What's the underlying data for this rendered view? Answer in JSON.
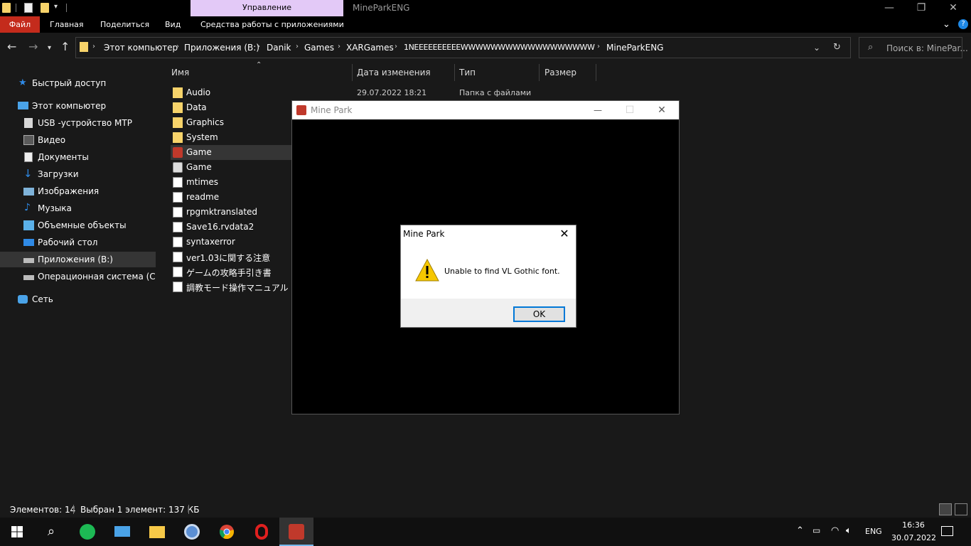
{
  "titlebar": {
    "manage_tab": "Управление",
    "window_title": "MineParkENG",
    "minimize": "—",
    "maximize": "❐",
    "close": "✕"
  },
  "ribbon": {
    "tabs": [
      "Файл",
      "Главная",
      "Поделиться",
      "Вид",
      "Средства работы с приложениями"
    ],
    "expand_icon": "⌄",
    "help_icon": "?"
  },
  "address": {
    "crumbs": [
      "Этот компьютер",
      "Приложения (B:)",
      "Danik",
      "Games",
      "XARGames",
      "1NEEEEEEEEEEWWWWWWWWWWWWWWWWWW",
      "MineParkENG"
    ],
    "search_placeholder": "Поиск в: MinePar..."
  },
  "nav": {
    "items": [
      {
        "label": "Быстрый доступ",
        "icon": "star-icon"
      },
      {
        "label": "Этот компьютер",
        "icon": "computer-icon"
      },
      {
        "label": "USB -устройство MTP",
        "icon": "usb-device-icon"
      },
      {
        "label": "Видео",
        "icon": "video-icon"
      },
      {
        "label": "Документы",
        "icon": "documents-icon"
      },
      {
        "label": "Загрузки",
        "icon": "downloads-icon"
      },
      {
        "label": "Изображения",
        "icon": "pictures-icon"
      },
      {
        "label": "Музыка",
        "icon": "music-icon"
      },
      {
        "label": "Объемные объекты",
        "icon": "3d-objects-icon"
      },
      {
        "label": "Рабочий стол",
        "icon": "desktop-icon"
      },
      {
        "label": "Приложения (B:)",
        "icon": "drive-icon"
      },
      {
        "label": "Операционная система (C:)",
        "icon": "drive-icon"
      },
      {
        "label": "Сеть",
        "icon": "network-icon"
      }
    ]
  },
  "filelist": {
    "columns": [
      "Имя",
      "Дата изменения",
      "Тип",
      "Размер"
    ],
    "first_row_date": "29.07.2022 18:21",
    "first_row_type": "Папка с файлами",
    "files": [
      {
        "name": "Audio",
        "icon": "folder-icon"
      },
      {
        "name": "Data",
        "icon": "folder-icon"
      },
      {
        "name": "Graphics",
        "icon": "folder-icon"
      },
      {
        "name": "System",
        "icon": "folder-icon"
      },
      {
        "name": "Game",
        "icon": "game-exe-icon"
      },
      {
        "name": "Game",
        "icon": "config-file-icon"
      },
      {
        "name": "mtimes",
        "icon": "file-icon"
      },
      {
        "name": "readme",
        "icon": "file-icon"
      },
      {
        "name": "rpgmktranslated",
        "icon": "file-icon"
      },
      {
        "name": "Save16.rvdata2",
        "icon": "file-icon"
      },
      {
        "name": "syntaxerror",
        "icon": "file-icon"
      },
      {
        "name": "ver1.03に関する注意",
        "icon": "text-file-icon"
      },
      {
        "name": "ゲームの攻略手引き書",
        "icon": "text-file-icon"
      },
      {
        "name": "調教モード操作マニュアル",
        "icon": "text-file-icon"
      }
    ]
  },
  "gamewindow": {
    "title": "Mine Park",
    "minimize": "—",
    "maximize": "☐",
    "close": "✕"
  },
  "msgbox": {
    "title": "Mine Park",
    "close": "✕",
    "message": "Unable to find VL Gothic font.",
    "ok_label": "OK"
  },
  "status": {
    "items_count": "Элементов: 14",
    "selected": "Выбран 1 элемент: 137 КБ"
  },
  "taskbar": {
    "apps": [
      "start-icon",
      "search-icon",
      "spotify-icon",
      "explorer-computer-icon",
      "file-explorer-icon",
      "app-globe-icon",
      "chrome-icon",
      "opera-icon",
      "mine-park-game-icon"
    ],
    "lang": "ENG",
    "time": "16:36",
    "date": "30.07.2022"
  },
  "colors": {
    "accent_file_tab": "#c42b1c",
    "manage_tab": "#e3c9f7",
    "ok_border": "#0078d7",
    "selection": "#353535"
  }
}
